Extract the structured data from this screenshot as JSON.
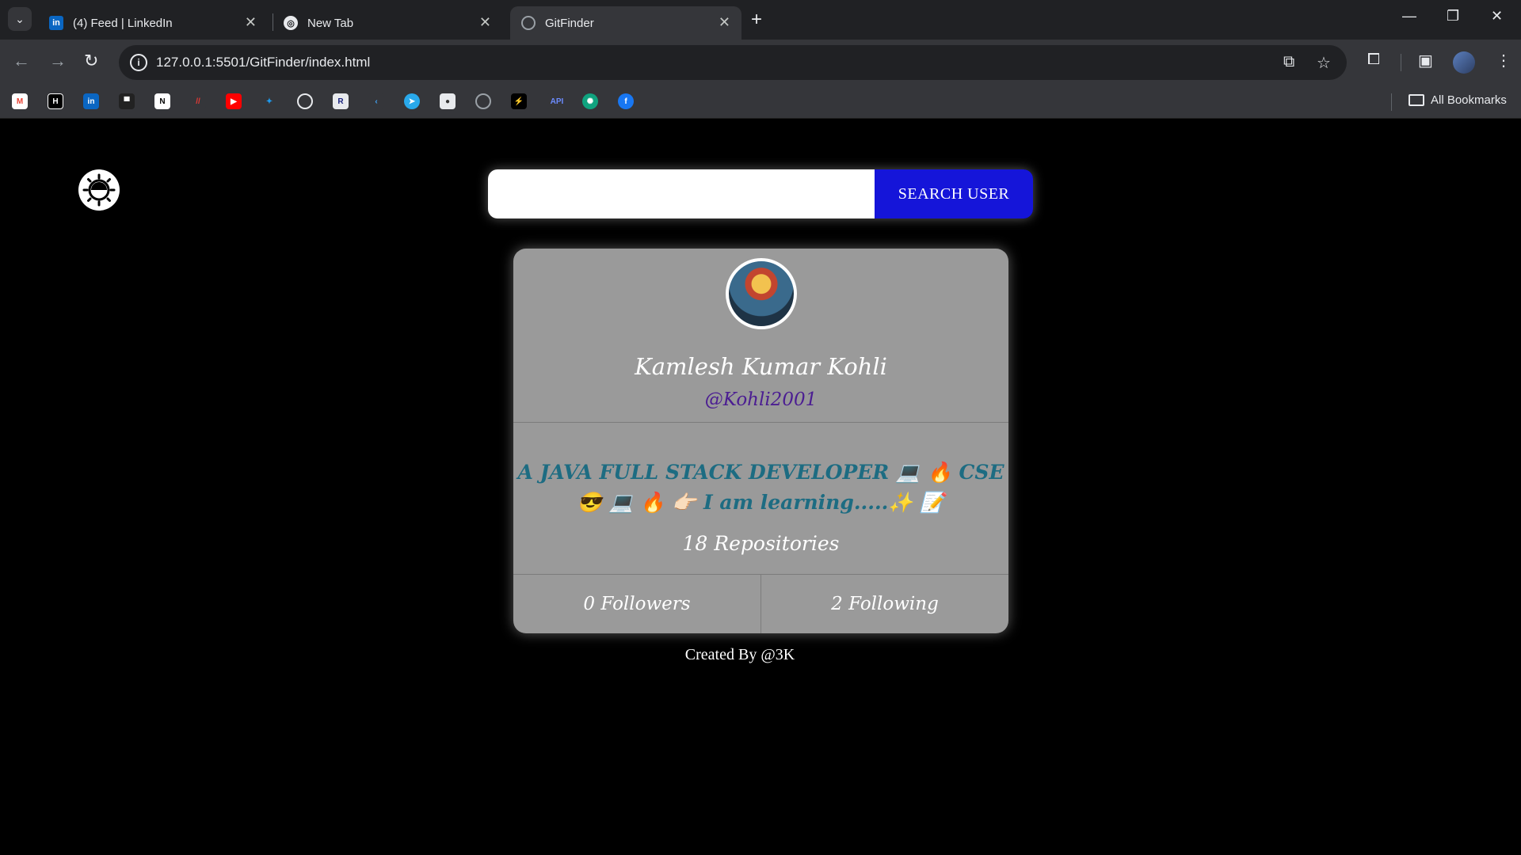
{
  "browser": {
    "tabs": [
      {
        "title": "(4) Feed | LinkedIn",
        "icon": "linkedin-icon"
      },
      {
        "title": "New Tab",
        "icon": "chrome-icon"
      },
      {
        "title": "GitFinder",
        "icon": "globe-icon"
      }
    ],
    "url": "127.0.0.1:5501/GitFinder/index.html",
    "bookmarks_label": "All Bookmarks",
    "bookmark_icons": [
      "gmail",
      "hashnode",
      "linkedin",
      "stack",
      "notion",
      "devfolio",
      "youtube",
      "twitter",
      "openai",
      "replit",
      "kotlin",
      "telegram",
      "profile",
      "github",
      "codepen",
      "api",
      "chatgpt",
      "facebook"
    ],
    "bookmark_api_label": "API"
  },
  "search": {
    "placeholder": "",
    "button_label": "SEARCH USER"
  },
  "profile": {
    "name": "Kamlesh Kumar Kohli",
    "login": "@Kohli2001",
    "bio": "A JAVA FULL STACK DEVELOPER 💻 🔥 CSE😎 💻 🔥 👉🏻 I am learning.....✨ 📝",
    "repos": "18 Repositories",
    "followers": "0 Followers",
    "following": "2 Following"
  },
  "footer": "Created By @3K"
}
